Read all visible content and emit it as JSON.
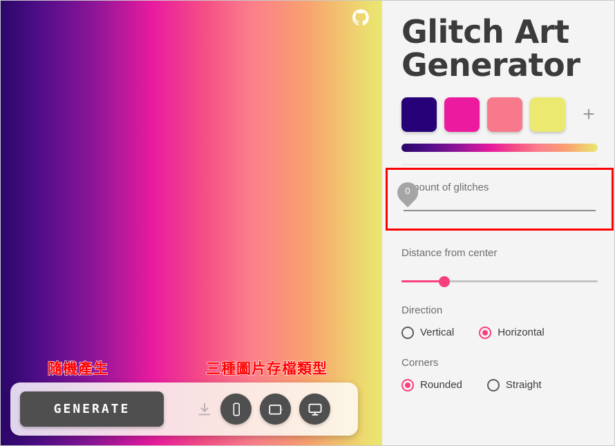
{
  "app": {
    "title": "Glitch Art Generator",
    "github_icon": "github-icon"
  },
  "canvas": {
    "gradient_colors": [
      "#2a0769",
      "#8b1597",
      "#e91b9f",
      "#fb7f8b",
      "#e9e870"
    ],
    "annotations": [
      {
        "text": "隨機產生",
        "color": "#ff0000"
      },
      {
        "text": "三種圖片存檔類型",
        "color": "#ff0000"
      }
    ]
  },
  "palette": {
    "swatches": [
      {
        "label": "color-1",
        "hex": "#260178"
      },
      {
        "label": "color-2",
        "hex": "#ec1a9e"
      },
      {
        "label": "color-3",
        "hex": "#f9798c"
      },
      {
        "label": "color-4",
        "hex": "#ece971"
      }
    ],
    "add_label": "+"
  },
  "controls": {
    "glitches": {
      "label": "Amount of glitches",
      "value": "0",
      "min": "0",
      "max": "100",
      "highlight_color": "#ff0000"
    },
    "distance": {
      "label": "Distance from center",
      "value": "22",
      "min": "0",
      "max": "100",
      "accent_color": "#f73f7d"
    },
    "direction": {
      "label": "Direction",
      "options": [
        {
          "label": "Vertical",
          "selected": false
        },
        {
          "label": "Horizontal",
          "selected": true
        }
      ]
    },
    "corners": {
      "label": "Corners",
      "options": [
        {
          "label": "Rounded",
          "selected": true
        },
        {
          "label": "Straight",
          "selected": false
        }
      ]
    }
  },
  "toolbar": {
    "generate_label": "GENERATE",
    "download_icon": "download-icon",
    "devices": [
      {
        "name": "phone-export-button",
        "icon": "mobile-phone-icon"
      },
      {
        "name": "tablet-export-button",
        "icon": "tablet-icon"
      },
      {
        "name": "desktop-export-button",
        "icon": "desktop-monitor-icon"
      }
    ]
  }
}
